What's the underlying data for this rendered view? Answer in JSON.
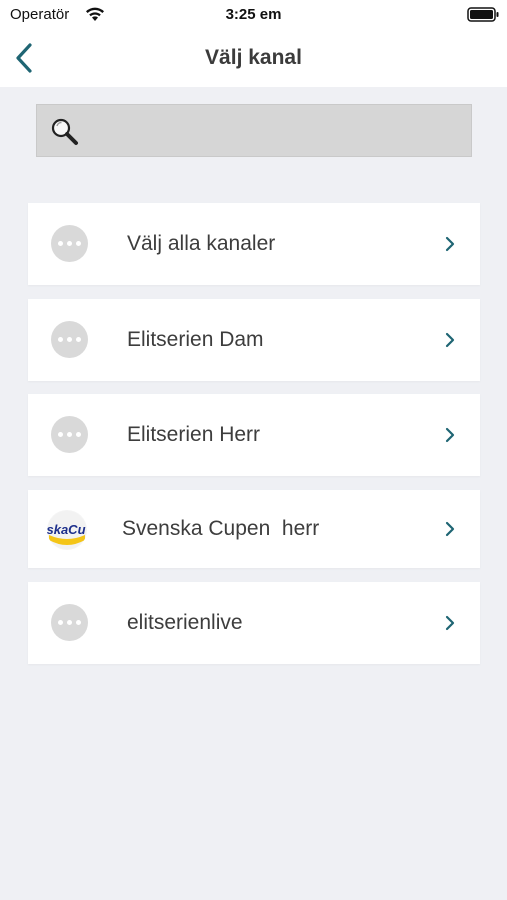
{
  "status_bar": {
    "carrier": "Operatör",
    "time": "3:25 em"
  },
  "nav": {
    "title": "Välj kanal",
    "back_icon": "chevron-left-icon"
  },
  "search": {
    "placeholder": "",
    "value": "",
    "icon": "search-icon"
  },
  "channels": [
    {
      "label": "Välj alla kanaler",
      "avatar": "more-dots-icon"
    },
    {
      "label": "Elitserien Dam",
      "avatar": "more-dots-icon"
    },
    {
      "label": "Elitserien Herr",
      "avatar": "more-dots-icon"
    },
    {
      "label": "Svenska Cupen  herr",
      "avatar": "svenska-cupen-logo",
      "logo_text": "skaCu"
    },
    {
      "label": "elitserienlive",
      "avatar": "more-dots-icon"
    }
  ],
  "colors": {
    "accent": "#1f6573",
    "background": "#eff0f4",
    "row_background": "#ffffff",
    "search_background": "#d6d6d6",
    "avatar_placeholder": "#d9d9d9"
  }
}
